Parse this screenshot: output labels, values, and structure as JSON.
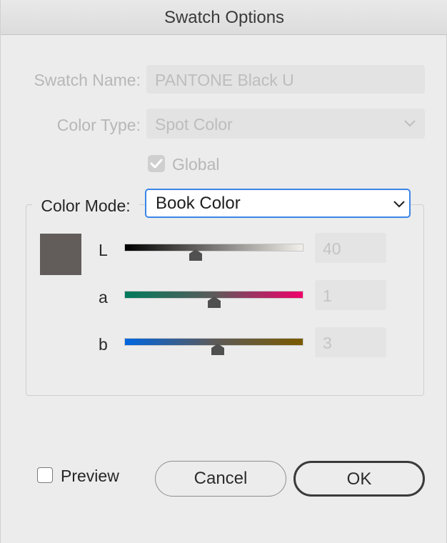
{
  "dialog": {
    "title": "Swatch Options"
  },
  "swatch_name": {
    "label": "Swatch Name:",
    "value": "PANTONE Black U"
  },
  "color_type": {
    "label": "Color Type:",
    "value": "Spot Color"
  },
  "global": {
    "label": "Global",
    "checked": true
  },
  "color_mode": {
    "label": "Color Mode:",
    "value": "Book Color"
  },
  "swatch_preview": {
    "color": "#625d5b"
  },
  "sliders": [
    {
      "label": "L",
      "value": "40",
      "position": 0.4
    },
    {
      "label": "a",
      "value": "1",
      "position": 0.5
    },
    {
      "label": "b",
      "value": "3",
      "position": 0.52
    }
  ],
  "preview": {
    "label": "Preview",
    "checked": false
  },
  "buttons": {
    "cancel": "Cancel",
    "ok": "OK"
  }
}
